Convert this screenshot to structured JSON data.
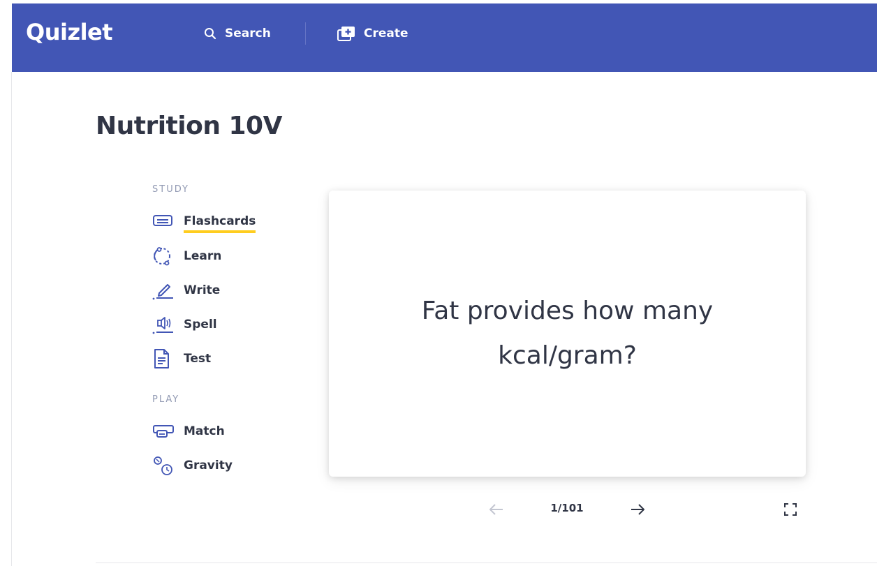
{
  "header": {
    "logo": "Quizlet",
    "search_label": "Search",
    "create_label": "Create",
    "background_color": "#4256b5"
  },
  "page": {
    "title": "Nutrition 10V"
  },
  "sidebar": {
    "study_heading": "STUDY",
    "study_items": [
      {
        "label": "Flashcards",
        "icon": "flashcards-icon",
        "active": true
      },
      {
        "label": "Learn",
        "icon": "learn-icon"
      },
      {
        "label": "Write",
        "icon": "write-icon"
      },
      {
        "label": "Spell",
        "icon": "spell-icon"
      },
      {
        "label": "Test",
        "icon": "test-icon"
      }
    ],
    "play_heading": "PLAY",
    "play_items": [
      {
        "label": "Match",
        "icon": "match-icon"
      },
      {
        "label": "Gravity",
        "icon": "gravity-icon"
      }
    ],
    "active_underline_color": "#ffcd1f"
  },
  "flashcard": {
    "term": "Fat provides how many kcal/gram?"
  },
  "controls": {
    "counter": "1/101",
    "prev_icon": "arrow-left-icon",
    "next_icon": "arrow-right-icon",
    "fullscreen_icon": "fullscreen-icon"
  }
}
